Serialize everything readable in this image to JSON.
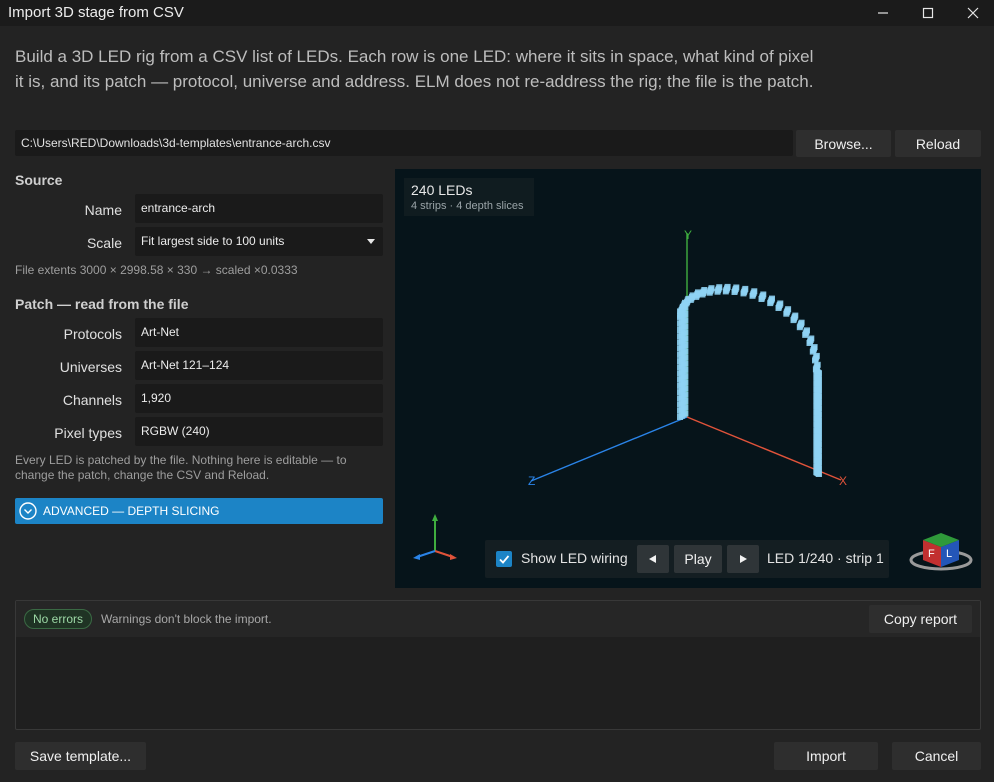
{
  "window": {
    "title": "Import 3D stage from CSV",
    "minimize_icon": "minimize-icon",
    "maximize_icon": "maximize-icon",
    "close_icon": "close-icon"
  },
  "intro": "Build a 3D LED rig from a CSV list of LEDs. Each row is one LED: where it sits in space, what kind of pixel it is, and its patch — protocol, universe and address. ELM does not re-address the rig; the file is the patch.",
  "file": {
    "path": "C:\\Users\\RED\\Downloads\\3d-templates\\entrance-arch.csv",
    "browse_label": "Browse...",
    "reload_label": "Reload"
  },
  "source": {
    "heading": "Source",
    "name_label": "Name",
    "name_value": "entrance-arch",
    "scale_label": "Scale",
    "scale_value": "Fit largest side to 100 units",
    "extents": "File extents 3000 × 2998.58 × 330 → scaled ×0.0333"
  },
  "patch": {
    "heading": "Patch — read from the file",
    "protocols_label": "Protocols",
    "protocols_value": "Art-Net",
    "universes_label": "Universes",
    "universes_value": "Art-Net 121–124",
    "channels_label": "Channels",
    "channels_value": "1,920",
    "pixel_types_label": "Pixel types",
    "pixel_types_value": "RGBW (240)",
    "note": "Every LED is patched by the file. Nothing here is editable — to change the patch, change the CSV and Reload."
  },
  "advanced": {
    "label": "ADVANCED — DEPTH SLICING",
    "icon": "chevron-down-circle-icon"
  },
  "viewport": {
    "led_count": "240 LEDs",
    "summary": "4 strips · 4 depth slices",
    "axis_x": "X",
    "axis_y": "Y",
    "axis_z": "Z",
    "cube_labels": [
      "F",
      "L"
    ],
    "colors": {
      "background": "#06141a",
      "led": "#8fd3f4",
      "x_axis": "#e0533a",
      "y_axis": "#3fae3f",
      "z_axis": "#2a84e8"
    }
  },
  "controls": {
    "wiring_label": "Show LED wiring",
    "wiring_checked": true,
    "prev_icon": "triangle-left-icon",
    "play_label": "Play",
    "next_icon": "triangle-right-icon",
    "status": "LED 1/240 · strip 1"
  },
  "report": {
    "badge": "No errors",
    "warnings": "Warnings don't block the import.",
    "copy_label": "Copy report"
  },
  "footer": {
    "save_label": "Save template...",
    "import_label": "Import",
    "cancel_label": "Cancel"
  }
}
